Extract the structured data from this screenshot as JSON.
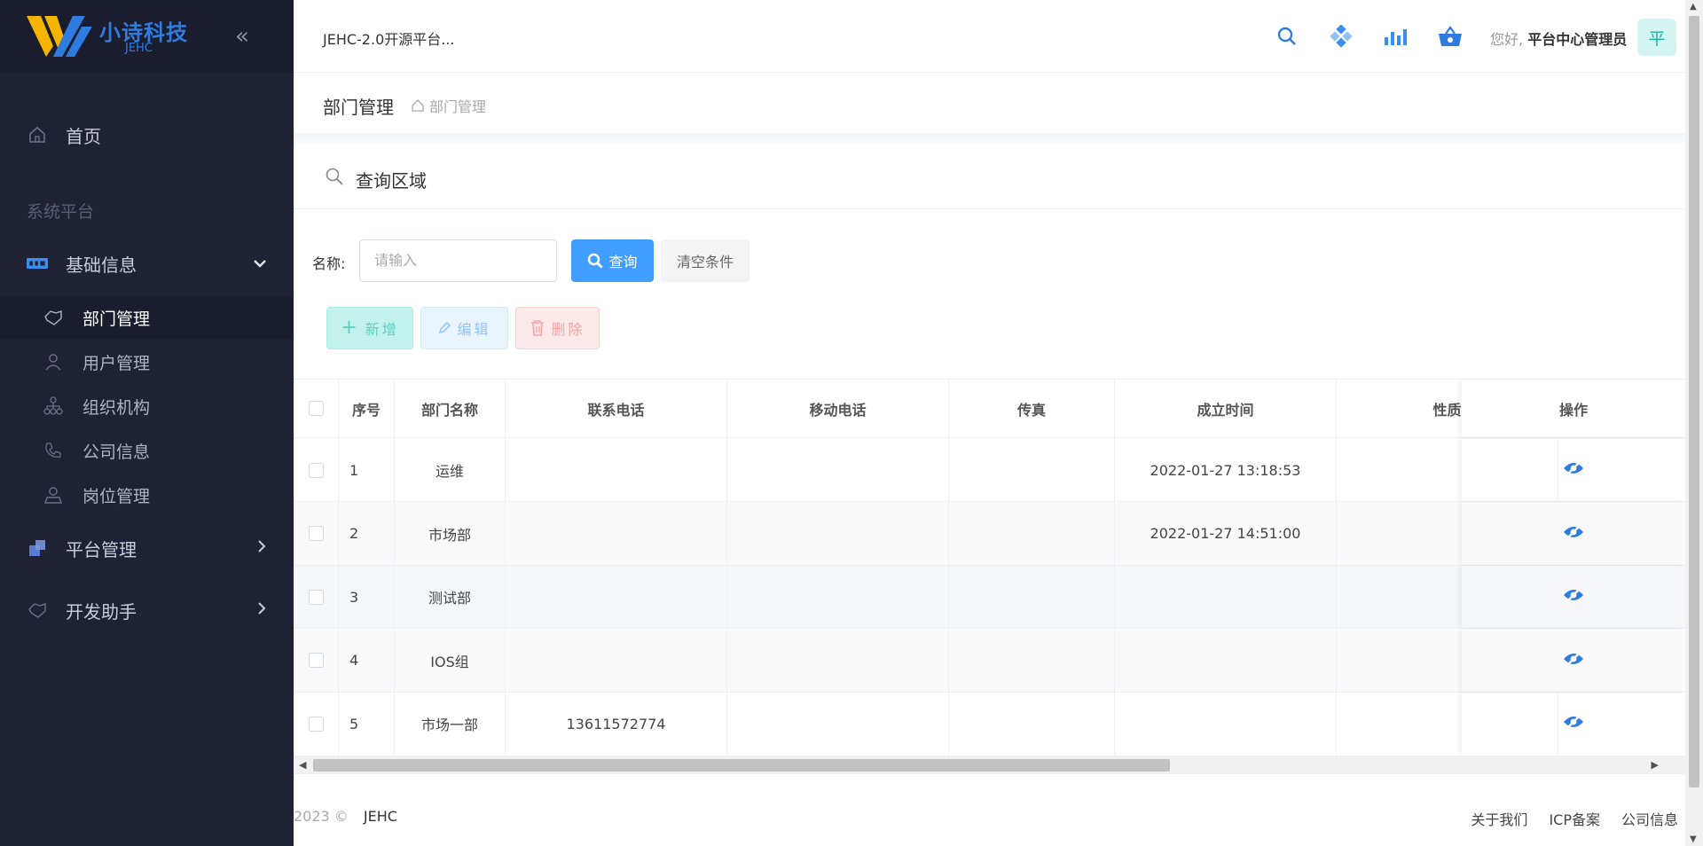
{
  "brand": {
    "name": "小诗科技",
    "sub": "JEHC"
  },
  "sidebar": {
    "home": "首页",
    "section": "系统平台",
    "groups": [
      {
        "label": "基础信息",
        "expanded": true
      },
      {
        "label": "平台管理",
        "expanded": false
      },
      {
        "label": "开发助手",
        "expanded": false
      }
    ],
    "sub_items": [
      {
        "label": "部门管理",
        "active": true
      },
      {
        "label": "用户管理"
      },
      {
        "label": "组织机构"
      },
      {
        "label": "公司信息"
      },
      {
        "label": "岗位管理"
      }
    ]
  },
  "header": {
    "site_title": "JEHC-2.0开源平台...",
    "greeting": "您好,",
    "user": "平台中心管理员",
    "avatar_text": "平"
  },
  "page": {
    "title": "部门管理",
    "breadcrumb": "部门管理"
  },
  "query": {
    "title": "查询区域",
    "name_label": "名称:",
    "name_placeholder": "请输入",
    "search_label": "查询",
    "clear_label": "清空条件"
  },
  "actions": {
    "add": "新增",
    "edit": "编辑",
    "delete": "删除"
  },
  "table": {
    "headers": [
      "序号",
      "部门名称",
      "联系电话",
      "移动电话",
      "传真",
      "成立时间",
      "性质",
      "操作"
    ],
    "rows": [
      {
        "no": "1",
        "name": "运维",
        "phone": "",
        "mobile": "",
        "fax": "",
        "created": "2022-01-27 13:18:53",
        "nature": ""
      },
      {
        "no": "2",
        "name": "市场部",
        "phone": "",
        "mobile": "",
        "fax": "",
        "created": "2022-01-27 14:51:00",
        "nature": ""
      },
      {
        "no": "3",
        "name": "测试部",
        "phone": "",
        "mobile": "",
        "fax": "",
        "created": "",
        "nature": ""
      },
      {
        "no": "4",
        "name": "IOS组",
        "phone": "",
        "mobile": "",
        "fax": "",
        "created": "",
        "nature": ""
      },
      {
        "no": "5",
        "name": "市场一部",
        "phone": "13611572774",
        "mobile": "",
        "fax": "",
        "created": "",
        "nature": ""
      }
    ]
  },
  "footer": {
    "copyright": "2023 ©",
    "brand": "JEHC",
    "links": [
      "关于我们",
      "ICP备案",
      "公司信息"
    ]
  },
  "colors": {
    "sidebar_bg": "#1f2235",
    "primary": "#409eff",
    "accent_teal": "#20b2a0"
  }
}
